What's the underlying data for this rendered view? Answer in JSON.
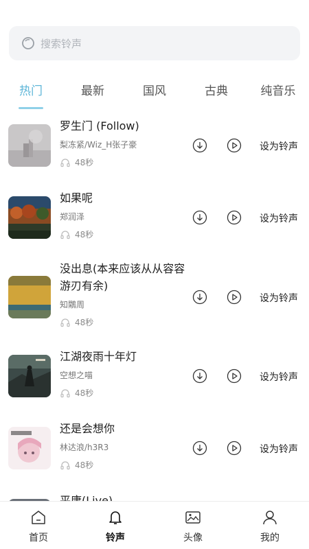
{
  "search": {
    "placeholder": "搜索铃声"
  },
  "tabs": [
    {
      "label": "热门",
      "active": true
    },
    {
      "label": "最新",
      "active": false
    },
    {
      "label": "国风",
      "active": false
    },
    {
      "label": "古典",
      "active": false
    },
    {
      "label": "纯音乐",
      "active": false
    }
  ],
  "songs": [
    {
      "title": "罗生门 (Follow)",
      "artist": "梨冻紧/Wiz_H张子豪",
      "duration": "48秒",
      "set_label": "设为铃声",
      "cover_icon": "misty-city-cover"
    },
    {
      "title": "如果呢",
      "artist": "郑润泽",
      "duration": "48秒",
      "set_label": "设为铃声",
      "cover_icon": "autumn-forest-cover"
    },
    {
      "title": "没出息(本来应该从从容容游刃有余)",
      "artist": "知鷴周",
      "duration": "48秒",
      "set_label": "设为铃声",
      "cover_icon": "golden-field-cover"
    },
    {
      "title": "江湖夜雨十年灯",
      "artist": "空想之喵",
      "duration": "48秒",
      "set_label": "设为铃声",
      "cover_icon": "ink-warrior-cover"
    },
    {
      "title": "还是会想你",
      "artist": "林达浪/h3R3",
      "duration": "48秒",
      "set_label": "设为铃声",
      "cover_icon": "anime-girl-cover"
    },
    {
      "title": "平庸(Live)"
    }
  ],
  "nav": [
    {
      "label": "首页",
      "icon": "home-icon",
      "active": false
    },
    {
      "label": "铃声",
      "icon": "bell-icon",
      "active": true
    },
    {
      "label": "头像",
      "icon": "image-icon",
      "active": false
    },
    {
      "label": "我的",
      "icon": "user-icon",
      "active": false
    }
  ],
  "colors": {
    "accent": "#5fb6d8",
    "underline": "#8fd0e8",
    "search_bg": "#f3f4f6"
  }
}
